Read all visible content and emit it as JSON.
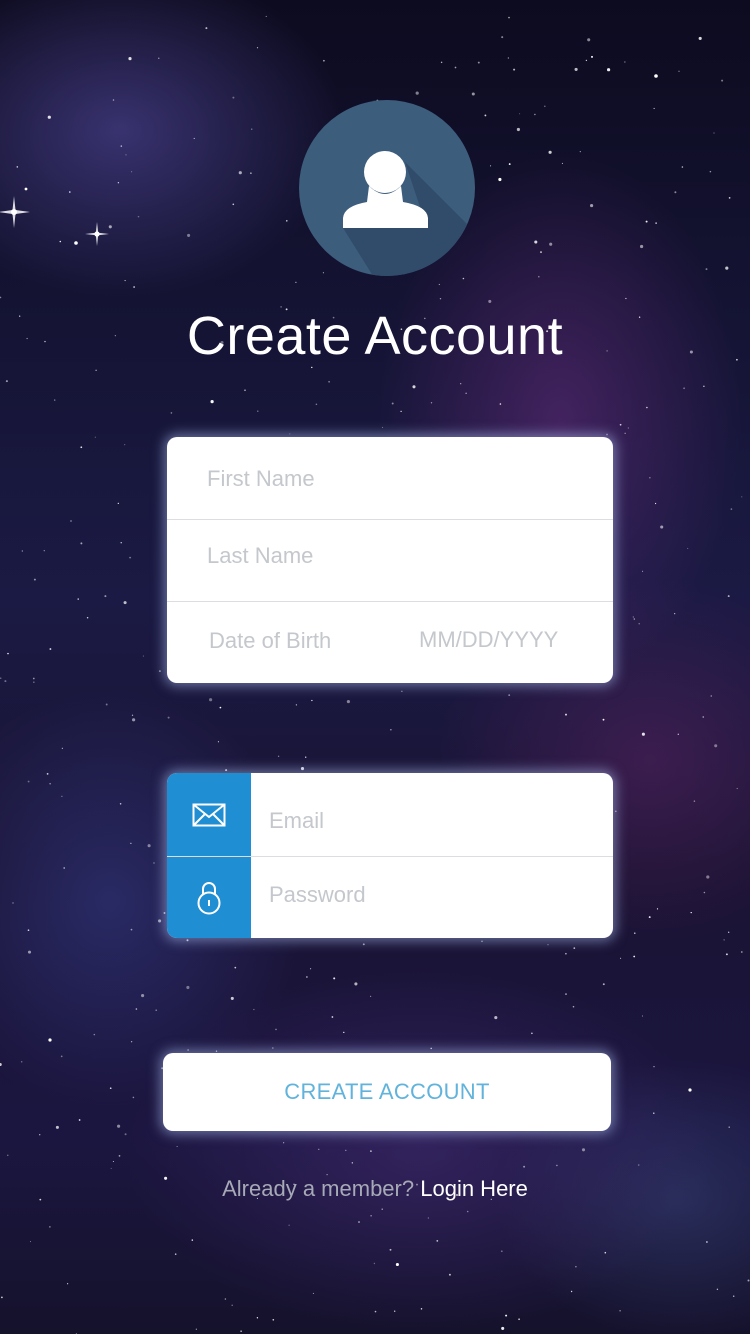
{
  "header": {
    "title": "Create Account",
    "avatar_icon": "user-icon"
  },
  "profile_form": {
    "first_name_placeholder": "First Name",
    "last_name_placeholder": "Last Name",
    "dob_label": "Date of Birth",
    "dob_placeholder": "MM/DD/YYYY"
  },
  "login_form": {
    "email_placeholder": "Email",
    "password_placeholder": "Password",
    "email_icon": "envelope-icon",
    "password_icon": "lock-icon"
  },
  "actions": {
    "create_label": "CREATE ACCOUNT"
  },
  "footer": {
    "prompt": "Already a member?",
    "link": "Login Here"
  },
  "colors": {
    "accent": "#1f8ed2",
    "avatar_bg": "#3d5d7d",
    "button_text": "#61b3dc"
  }
}
